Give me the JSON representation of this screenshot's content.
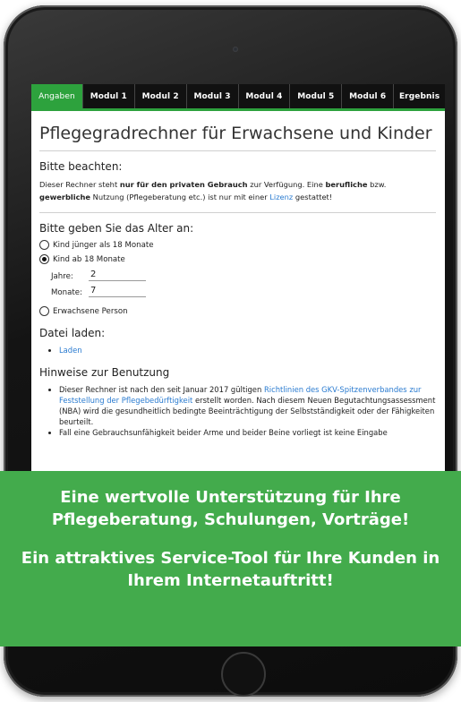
{
  "tabs": [
    "Angaben",
    "Modul 1",
    "Modul 2",
    "Modul 3",
    "Modul 4",
    "Modul 5",
    "Modul 6",
    "Ergebnis"
  ],
  "active_tab": "Angaben",
  "title": "Pflegegradrechner für Erwachsene und Kinder",
  "notice": {
    "heading": "Bitte beachten:",
    "t1": "Dieser Rechner steht ",
    "b1": "nur für den privaten Gebrauch",
    "t2": " zur Verfügung. Eine ",
    "b2": "berufliche",
    "t3": " bzw. ",
    "b3": "gewerbliche",
    "t4": " Nutzung (Pflegeberatung etc.) ist nur mit einer ",
    "link": "Lizenz",
    "t5": " gestattet!"
  },
  "age": {
    "heading": "Bitte geben Sie das Alter an:",
    "option_child_under": "Kind jünger als 18 Monate",
    "option_child_over": "Kind ab 18 Monate",
    "years_label": "Jahre:",
    "years_value": "2",
    "months_label": "Monate:",
    "months_value": "7",
    "option_adult": "Erwachsene Person"
  },
  "file": {
    "heading": "Datei laden:",
    "load_link": "Laden"
  },
  "usage": {
    "heading": "Hinweise zur Benutzung",
    "t1": "Dieser Rechner ist nach den seit Januar 2017 gültigen ",
    "link": "Richtlinien des GKV-Spitzenverbandes zur Feststellung der Pflegebedürftigkeit",
    "t2": " erstellt worden. Nach diesem Neuen Begutachtungsassessment (NBA) wird die gesundheitlich bedingte Beeinträchtigung der Selbstständigkeit oder der Fähigkeiten beurteilt.",
    "t3": "Fall eine Gebrauchsunfähigkeit beider Arme und beider Beine vorliegt ist keine Eingabe"
  },
  "banner": {
    "line1": "Eine wertvolle Unterstützung für Ihre",
    "line2": "Pflegeberatung, Schulungen, Vorträge!",
    "line3": "Ein attraktives Service-Tool für Ihre Kunden in",
    "line4": "Ihrem Internetauftritt!"
  },
  "colors": {
    "accent_green": "#2da23d",
    "banner_green": "#43ab4c",
    "tab_bar": "#111111",
    "link_blue": "#2a7bd0"
  }
}
